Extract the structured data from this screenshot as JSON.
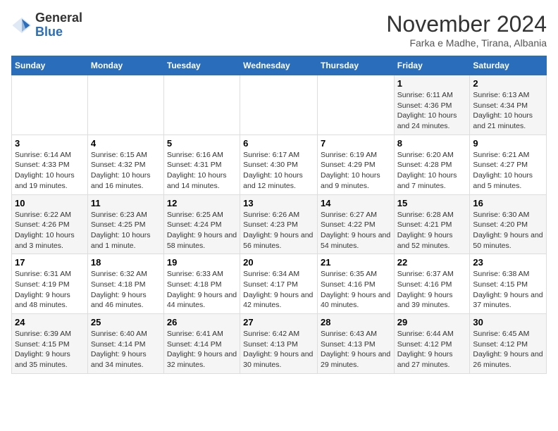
{
  "logo": {
    "general": "General",
    "blue": "Blue"
  },
  "title": "November 2024",
  "location": "Farka e Madhe, Tirana, Albania",
  "days_of_week": [
    "Sunday",
    "Monday",
    "Tuesday",
    "Wednesday",
    "Thursday",
    "Friday",
    "Saturday"
  ],
  "weeks": [
    [
      {
        "day": "",
        "info": ""
      },
      {
        "day": "",
        "info": ""
      },
      {
        "day": "",
        "info": ""
      },
      {
        "day": "",
        "info": ""
      },
      {
        "day": "",
        "info": ""
      },
      {
        "day": "1",
        "info": "Sunrise: 6:11 AM\nSunset: 4:36 PM\nDaylight: 10 hours and 24 minutes."
      },
      {
        "day": "2",
        "info": "Sunrise: 6:13 AM\nSunset: 4:34 PM\nDaylight: 10 hours and 21 minutes."
      }
    ],
    [
      {
        "day": "3",
        "info": "Sunrise: 6:14 AM\nSunset: 4:33 PM\nDaylight: 10 hours and 19 minutes."
      },
      {
        "day": "4",
        "info": "Sunrise: 6:15 AM\nSunset: 4:32 PM\nDaylight: 10 hours and 16 minutes."
      },
      {
        "day": "5",
        "info": "Sunrise: 6:16 AM\nSunset: 4:31 PM\nDaylight: 10 hours and 14 minutes."
      },
      {
        "day": "6",
        "info": "Sunrise: 6:17 AM\nSunset: 4:30 PM\nDaylight: 10 hours and 12 minutes."
      },
      {
        "day": "7",
        "info": "Sunrise: 6:19 AM\nSunset: 4:29 PM\nDaylight: 10 hours and 9 minutes."
      },
      {
        "day": "8",
        "info": "Sunrise: 6:20 AM\nSunset: 4:28 PM\nDaylight: 10 hours and 7 minutes."
      },
      {
        "day": "9",
        "info": "Sunrise: 6:21 AM\nSunset: 4:27 PM\nDaylight: 10 hours and 5 minutes."
      }
    ],
    [
      {
        "day": "10",
        "info": "Sunrise: 6:22 AM\nSunset: 4:26 PM\nDaylight: 10 hours and 3 minutes."
      },
      {
        "day": "11",
        "info": "Sunrise: 6:23 AM\nSunset: 4:25 PM\nDaylight: 10 hours and 1 minute."
      },
      {
        "day": "12",
        "info": "Sunrise: 6:25 AM\nSunset: 4:24 PM\nDaylight: 9 hours and 58 minutes."
      },
      {
        "day": "13",
        "info": "Sunrise: 6:26 AM\nSunset: 4:23 PM\nDaylight: 9 hours and 56 minutes."
      },
      {
        "day": "14",
        "info": "Sunrise: 6:27 AM\nSunset: 4:22 PM\nDaylight: 9 hours and 54 minutes."
      },
      {
        "day": "15",
        "info": "Sunrise: 6:28 AM\nSunset: 4:21 PM\nDaylight: 9 hours and 52 minutes."
      },
      {
        "day": "16",
        "info": "Sunrise: 6:30 AM\nSunset: 4:20 PM\nDaylight: 9 hours and 50 minutes."
      }
    ],
    [
      {
        "day": "17",
        "info": "Sunrise: 6:31 AM\nSunset: 4:19 PM\nDaylight: 9 hours and 48 minutes."
      },
      {
        "day": "18",
        "info": "Sunrise: 6:32 AM\nSunset: 4:18 PM\nDaylight: 9 hours and 46 minutes."
      },
      {
        "day": "19",
        "info": "Sunrise: 6:33 AM\nSunset: 4:18 PM\nDaylight: 9 hours and 44 minutes."
      },
      {
        "day": "20",
        "info": "Sunrise: 6:34 AM\nSunset: 4:17 PM\nDaylight: 9 hours and 42 minutes."
      },
      {
        "day": "21",
        "info": "Sunrise: 6:35 AM\nSunset: 4:16 PM\nDaylight: 9 hours and 40 minutes."
      },
      {
        "day": "22",
        "info": "Sunrise: 6:37 AM\nSunset: 4:16 PM\nDaylight: 9 hours and 39 minutes."
      },
      {
        "day": "23",
        "info": "Sunrise: 6:38 AM\nSunset: 4:15 PM\nDaylight: 9 hours and 37 minutes."
      }
    ],
    [
      {
        "day": "24",
        "info": "Sunrise: 6:39 AM\nSunset: 4:15 PM\nDaylight: 9 hours and 35 minutes."
      },
      {
        "day": "25",
        "info": "Sunrise: 6:40 AM\nSunset: 4:14 PM\nDaylight: 9 hours and 34 minutes."
      },
      {
        "day": "26",
        "info": "Sunrise: 6:41 AM\nSunset: 4:14 PM\nDaylight: 9 hours and 32 minutes."
      },
      {
        "day": "27",
        "info": "Sunrise: 6:42 AM\nSunset: 4:13 PM\nDaylight: 9 hours and 30 minutes."
      },
      {
        "day": "28",
        "info": "Sunrise: 6:43 AM\nSunset: 4:13 PM\nDaylight: 9 hours and 29 minutes."
      },
      {
        "day": "29",
        "info": "Sunrise: 6:44 AM\nSunset: 4:12 PM\nDaylight: 9 hours and 27 minutes."
      },
      {
        "day": "30",
        "info": "Sunrise: 6:45 AM\nSunset: 4:12 PM\nDaylight: 9 hours and 26 minutes."
      }
    ]
  ]
}
